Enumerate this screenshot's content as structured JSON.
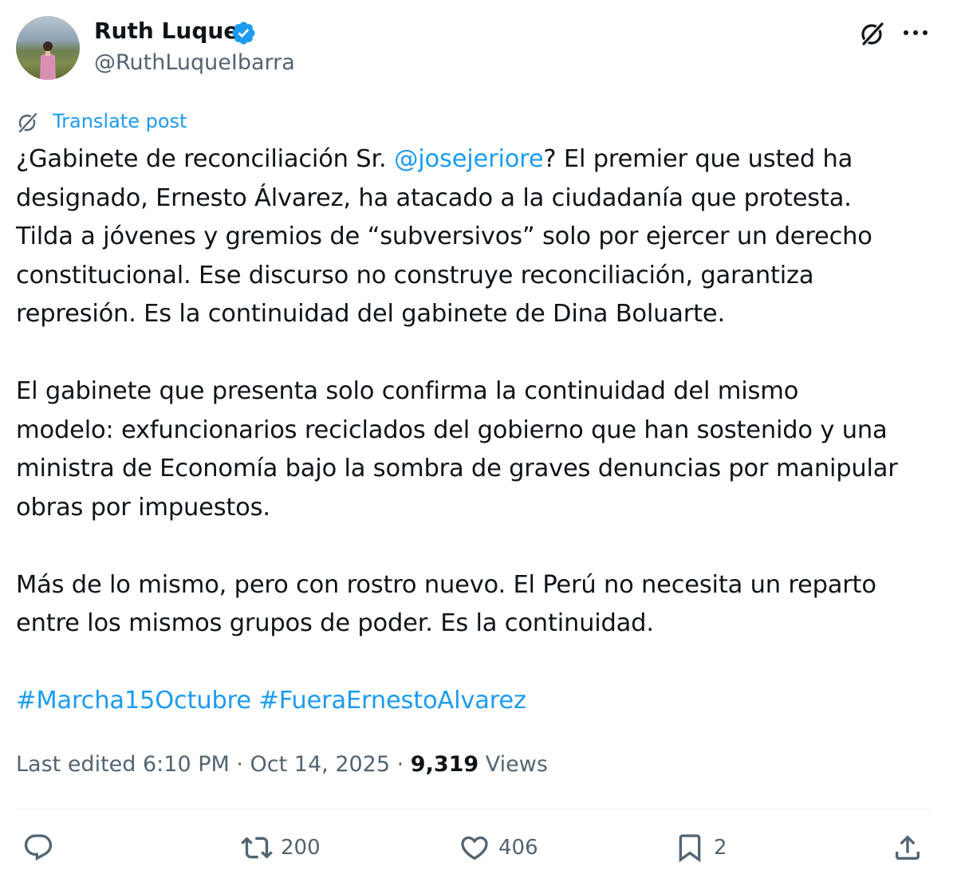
{
  "author": {
    "display_name": "Ruth Luque",
    "handle": "@RuthLuqueIbarra"
  },
  "translate_label": "Translate post",
  "tweet": {
    "p1_before": "¿Gabinete de reconciliación Sr. ",
    "p1_mention": "@josejeriore",
    "p1_after": "? El premier que usted ha",
    "lines_p1": [
      "designado, Ernesto Álvarez, ha atacado a la ciudadanía que protesta.",
      "Tilda a jóvenes y gremios de “subversivos” solo por ejercer un derecho",
      "constitucional. Ese discurso no construye reconciliación, garantiza",
      "represión. Es la continuidad del gabinete de Dina Boluarte."
    ],
    "lines_p2": [
      "El gabinete que presenta solo confirma la continuidad del mismo",
      "modelo: exfuncionarios reciclados del gobierno que han sostenido  y una",
      "ministra de Economía bajo la sombra de graves denuncias por manipular",
      "obras por impuestos."
    ],
    "lines_p3": [
      "Más de lo mismo, pero con rostro nuevo. El Perú no necesita un reparto",
      "entre los mismos grupos de poder. Es la continuidad."
    ],
    "hashtags": [
      "#Marcha15Octubre",
      "#FueraErnestoAlvarez"
    ]
  },
  "meta": {
    "edited": "Last edited 6:10 PM · Oct 14, 2025 · ",
    "views_count": "9,319",
    "views_label": " Views"
  },
  "actions": {
    "reposts": "200",
    "likes": "406",
    "bookmarks": "2"
  },
  "colors": {
    "link": "#1d9bf0",
    "secondary": "#536471",
    "text": "#0f1419"
  },
  "icons": [
    "verified-badge-icon",
    "grok-icon",
    "more-icon",
    "translate-icon",
    "reply-icon",
    "repost-icon",
    "like-icon",
    "bookmark-icon",
    "share-icon"
  ]
}
